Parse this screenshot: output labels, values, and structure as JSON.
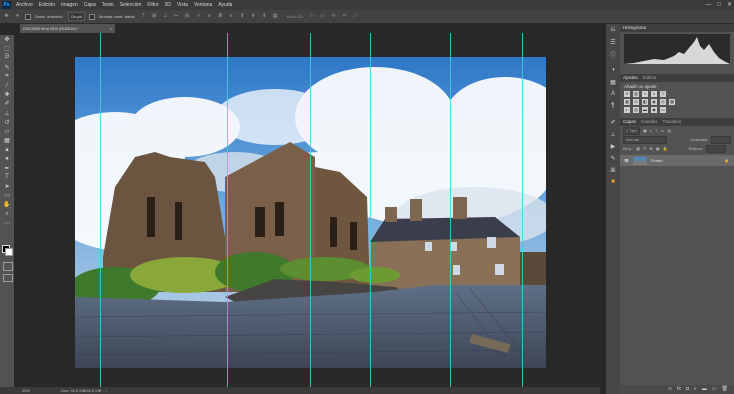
{
  "menu": {
    "logo": "Ps",
    "items": [
      "Archivo",
      "Edición",
      "Imagen",
      "Capa",
      "Texto",
      "Selección",
      "Filtro",
      "3D",
      "Vista",
      "Ventana",
      "Ayuda"
    ]
  },
  "window_controls": [
    "—",
    "□",
    "✕"
  ],
  "options_bar": {
    "auto_select_label": "Selec. automát.:",
    "auto_select_value": "Grupo",
    "show_transform_label": "Mostrar contr. transf.",
    "mode_3d_label": "Modo 3D:"
  },
  "document": {
    "tab_title": "DSC5069.tif al 25% (RGB/16) *",
    "tab_close": "×"
  },
  "status": {
    "zoom": "25%",
    "doc_size": "Doc: 92,0 MB/92,0 MB"
  },
  "panels": {
    "histogram_title": "Histograma",
    "adjustments_tab": "Ajustes",
    "styles_tab": "Estilos",
    "add_adjustment_label": "Añadir un ajuste",
    "layers_tabs": [
      "Capas",
      "Canales",
      "Trazados"
    ],
    "kind_label": "Tipo",
    "blend_mode": "Normal",
    "opacity_label": "Opacidad:",
    "lock_label": "Bloq.:",
    "fill_label": "Relleno:",
    "layer_name": "Fondo"
  },
  "icons": {
    "tools": [
      "move-icon",
      "marquee-icon",
      "lasso-icon",
      "quick-select-icon",
      "crop-icon",
      "eyedropper-icon",
      "healing-icon",
      "brush-icon",
      "stamp-icon",
      "history-brush-icon",
      "eraser-icon",
      "gradient-icon",
      "blur-icon",
      "dodge-icon",
      "pen-icon",
      "type-icon",
      "path-select-icon",
      "shape-icon",
      "hand-icon",
      "zoom-icon",
      "more-tools-icon"
    ],
    "colors": {
      "guide": "#3fd0d8",
      "panel_bg": "#535353",
      "workspace_bg": "#282828",
      "sky": "#3b7fc9"
    }
  }
}
